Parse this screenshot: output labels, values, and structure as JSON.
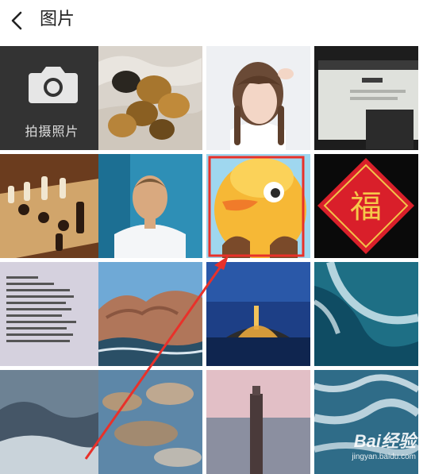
{
  "header": {
    "title": "图片"
  },
  "camera_tile": {
    "label": "拍摄照片"
  },
  "watermark": {
    "logo": "Bai经验",
    "url": "jingyan.baidu.com"
  },
  "colors": {
    "annotation_red": "#e8312a",
    "camera_bg": "#333333"
  },
  "icons": [
    "back-chevron-icon",
    "camera-icon",
    "paw-icon"
  ]
}
